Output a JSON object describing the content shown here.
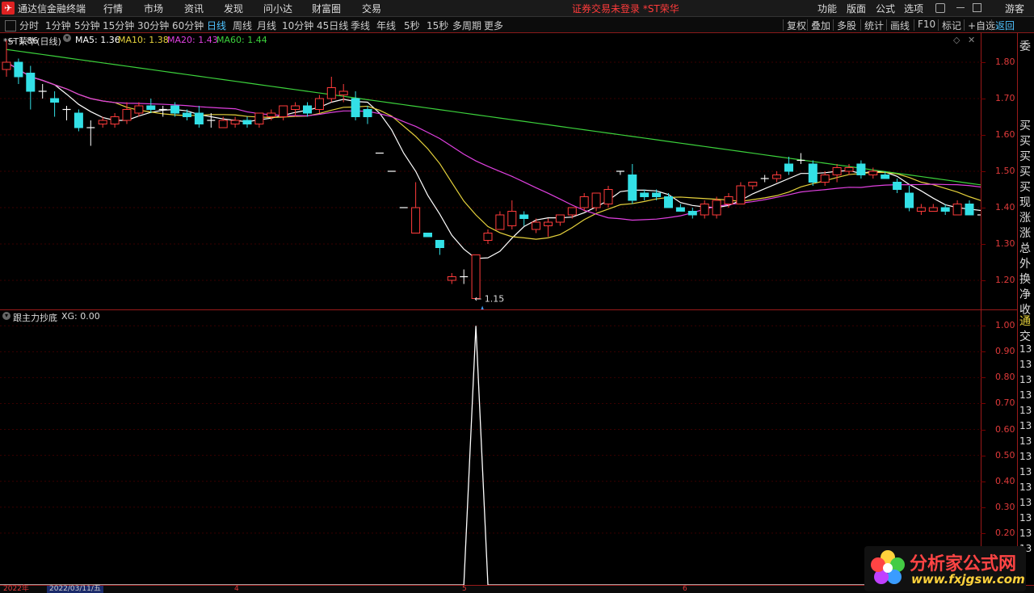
{
  "titlebar": {
    "logo": "✈",
    "app_name": "通达信金融终端",
    "menus": [
      "行情",
      "市场",
      "资讯",
      "发现",
      "问小达",
      "财富圈",
      "交易"
    ],
    "warning": "证券交易未登录  *ST荣华",
    "right_menus": [
      "功能",
      "版面",
      "公式",
      "选项"
    ],
    "user": "游客"
  },
  "toolbar": {
    "periods": [
      "分时",
      "1分钟",
      "5分钟",
      "15分钟",
      "30分钟",
      "60分钟",
      "日线",
      "周线",
      "月线",
      "10分钟",
      "45日线",
      "季线",
      "年线",
      "5秒",
      "15秒",
      "多周期",
      "更多"
    ],
    "active_period": "日线",
    "right_tools": [
      "复权",
      "叠加",
      "多股",
      "统计",
      "画线",
      "F10",
      "标记",
      "+自选",
      "返回"
    ]
  },
  "kline_header": {
    "stock": "*ST荣华(日线)",
    "ma5": "MA5: 1.36",
    "ma10": "MA10: 1.38",
    "ma20": "MA20: 1.43",
    "ma60": "MA60: 1.44",
    "colors": {
      "ma5": "#ffffff",
      "ma10": "#e6d23c",
      "ma20": "#e040e0",
      "ma60": "#3cd23c"
    }
  },
  "indicator_header": {
    "name": "跟主力抄底",
    "value": "XG: 0.00"
  },
  "price_axis": [
    "1.80",
    "1.70",
    "1.60",
    "1.50",
    "1.40",
    "1.30",
    "1.20"
  ],
  "indicator_axis": [
    "1.00",
    "0.90",
    "0.80",
    "0.70",
    "0.60",
    "0.50",
    "0.40",
    "0.30",
    "0.20"
  ],
  "annotations": {
    "high": "1.86",
    "low": "1.15"
  },
  "side_panel": {
    "top_chars": [
      "委",
      "买",
      "买",
      "买",
      "买",
      "买",
      "现",
      "涨",
      "涨",
      "总",
      "外",
      "换",
      "净",
      "收"
    ],
    "bottom_chars": [
      "通",
      "交",
      "13",
      "13",
      "13",
      "13",
      "13",
      "13",
      "13",
      "13",
      "13",
      "13",
      "13",
      "13",
      "13",
      "13"
    ]
  },
  "bottom_bar": {
    "year": "2022年",
    "date": "2022/03/11/五",
    "month_marks": [
      "4",
      "5",
      "6"
    ]
  },
  "watermark": {
    "cn": "分析家公式网",
    "url": "www.fxjgsw.com"
  },
  "chart_data": {
    "type": "candlestick",
    "title": "*ST荣华(日线)",
    "ylim": [
      1.12,
      1.88
    ],
    "candles": [
      [
        1.78,
        1.86,
        1.76,
        1.8
      ],
      [
        1.8,
        1.81,
        1.74,
        1.76
      ],
      [
        1.77,
        1.79,
        1.67,
        1.72
      ],
      [
        1.72,
        1.74,
        1.7,
        1.72
      ],
      [
        1.7,
        1.72,
        1.65,
        1.69
      ],
      [
        1.67,
        1.68,
        1.64,
        1.67
      ],
      [
        1.66,
        1.67,
        1.61,
        1.62
      ],
      [
        1.62,
        1.64,
        1.57,
        1.62
      ],
      [
        1.63,
        1.65,
        1.62,
        1.64
      ],
      [
        1.63,
        1.66,
        1.62,
        1.65
      ],
      [
        1.64,
        1.69,
        1.63,
        1.67
      ],
      [
        1.66,
        1.69,
        1.65,
        1.68
      ],
      [
        1.68,
        1.7,
        1.66,
        1.67
      ],
      [
        1.67,
        1.68,
        1.65,
        1.67
      ],
      [
        1.68,
        1.69,
        1.65,
        1.66
      ],
      [
        1.66,
        1.67,
        1.64,
        1.65
      ],
      [
        1.66,
        1.68,
        1.62,
        1.63
      ],
      [
        1.64,
        1.66,
        1.62,
        1.64
      ],
      [
        1.62,
        1.65,
        1.62,
        1.64
      ],
      [
        1.63,
        1.65,
        1.62,
        1.64
      ],
      [
        1.64,
        1.65,
        1.62,
        1.63
      ],
      [
        1.63,
        1.66,
        1.62,
        1.66
      ],
      [
        1.65,
        1.67,
        1.64,
        1.66
      ],
      [
        1.65,
        1.68,
        1.64,
        1.68
      ],
      [
        1.67,
        1.69,
        1.65,
        1.68
      ],
      [
        1.68,
        1.69,
        1.65,
        1.66
      ],
      [
        1.67,
        1.71,
        1.66,
        1.7
      ],
      [
        1.7,
        1.76,
        1.69,
        1.73
      ],
      [
        1.71,
        1.74,
        1.69,
        1.72
      ],
      [
        1.7,
        1.72,
        1.64,
        1.65
      ],
      [
        1.67,
        1.68,
        1.63,
        1.65
      ],
      [
        1.55,
        1.55,
        1.55,
        1.55
      ],
      [
        1.5,
        1.5,
        1.5,
        1.5
      ],
      [
        1.4,
        1.4,
        1.4,
        1.4
      ],
      [
        1.33,
        1.47,
        1.33,
        1.4
      ],
      [
        1.33,
        1.33,
        1.32,
        1.32
      ],
      [
        1.31,
        1.31,
        1.27,
        1.29
      ],
      [
        1.2,
        1.22,
        1.19,
        1.21
      ],
      [
        1.21,
        1.23,
        1.19,
        1.21
      ],
      [
        1.15,
        1.27,
        1.15,
        1.27
      ],
      [
        1.31,
        1.34,
        1.3,
        1.33
      ],
      [
        1.34,
        1.39,
        1.34,
        1.38
      ],
      [
        1.35,
        1.42,
        1.34,
        1.39
      ],
      [
        1.38,
        1.39,
        1.35,
        1.37
      ],
      [
        1.34,
        1.37,
        1.33,
        1.36
      ],
      [
        1.35,
        1.37,
        1.32,
        1.36
      ],
      [
        1.36,
        1.38,
        1.35,
        1.38
      ],
      [
        1.38,
        1.4,
        1.37,
        1.4
      ],
      [
        1.4,
        1.44,
        1.39,
        1.43
      ],
      [
        1.4,
        1.44,
        1.39,
        1.44
      ],
      [
        1.41,
        1.46,
        1.4,
        1.45
      ],
      [
        1.5,
        1.5,
        1.49,
        1.5
      ],
      [
        1.49,
        1.52,
        1.41,
        1.42
      ],
      [
        1.44,
        1.45,
        1.42,
        1.43
      ],
      [
        1.44,
        1.45,
        1.42,
        1.43
      ],
      [
        1.43,
        1.44,
        1.4,
        1.4
      ],
      [
        1.4,
        1.41,
        1.39,
        1.39
      ],
      [
        1.39,
        1.4,
        1.37,
        1.38
      ],
      [
        1.38,
        1.42,
        1.37,
        1.41
      ],
      [
        1.38,
        1.43,
        1.37,
        1.42
      ],
      [
        1.41,
        1.44,
        1.4,
        1.43
      ],
      [
        1.41,
        1.47,
        1.41,
        1.46
      ],
      [
        1.46,
        1.47,
        1.45,
        1.47
      ],
      [
        1.48,
        1.49,
        1.47,
        1.48
      ],
      [
        1.48,
        1.5,
        1.47,
        1.49
      ],
      [
        1.52,
        1.54,
        1.49,
        1.5
      ],
      [
        1.53,
        1.55,
        1.52,
        1.53
      ],
      [
        1.52,
        1.53,
        1.46,
        1.47
      ],
      [
        1.47,
        1.5,
        1.46,
        1.49
      ],
      [
        1.49,
        1.52,
        1.47,
        1.51
      ],
      [
        1.5,
        1.52,
        1.49,
        1.51
      ],
      [
        1.52,
        1.53,
        1.48,
        1.49
      ],
      [
        1.49,
        1.51,
        1.48,
        1.5
      ],
      [
        1.49,
        1.5,
        1.48,
        1.48
      ],
      [
        1.47,
        1.48,
        1.44,
        1.45
      ],
      [
        1.44,
        1.46,
        1.39,
        1.4
      ],
      [
        1.39,
        1.41,
        1.38,
        1.4
      ],
      [
        1.39,
        1.41,
        1.39,
        1.4
      ],
      [
        1.4,
        1.41,
        1.38,
        1.39
      ],
      [
        1.38,
        1.42,
        1.38,
        1.41
      ],
      [
        1.41,
        1.42,
        1.38,
        1.38
      ],
      [
        1.38,
        1.39,
        1.37,
        1.38
      ],
      [
        1.38,
        1.39,
        1.37,
        1.37
      ],
      [
        1.37,
        1.39,
        1.36,
        1.38
      ],
      [
        1.38,
        1.39,
        1.35,
        1.36
      ],
      [
        1.35,
        1.36,
        1.32,
        1.33
      ]
    ],
    "indicator": {
      "name": "XG",
      "ylim": [
        0,
        1.06
      ],
      "peak_index": 39,
      "peak_value": 1.0
    }
  }
}
